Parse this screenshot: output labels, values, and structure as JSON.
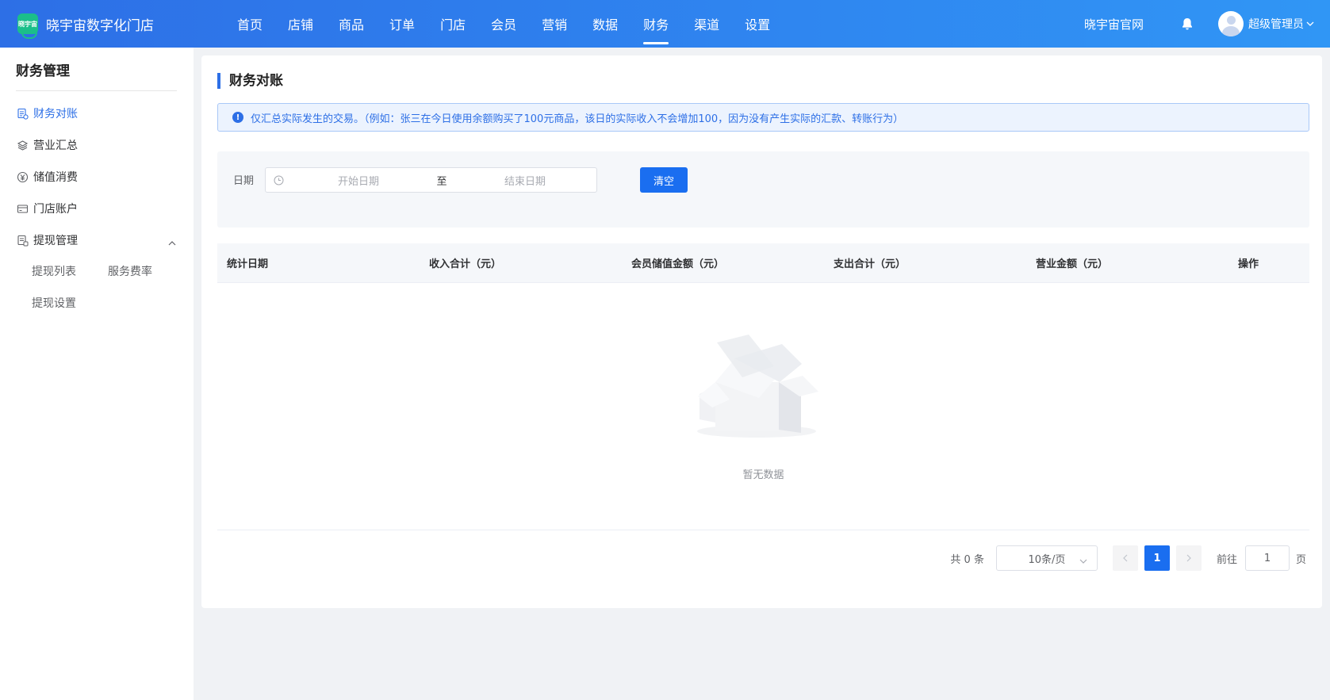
{
  "header": {
    "logo_text": "晓宇宙",
    "brand_title": "晓宇宙数字化门店",
    "nav": [
      {
        "label": "首页",
        "active": false
      },
      {
        "label": "店铺",
        "active": false
      },
      {
        "label": "商品",
        "active": false
      },
      {
        "label": "订单",
        "active": false
      },
      {
        "label": "门店",
        "active": false
      },
      {
        "label": "会员",
        "active": false
      },
      {
        "label": "营销",
        "active": false
      },
      {
        "label": "数据",
        "active": false
      },
      {
        "label": "财务",
        "active": true
      },
      {
        "label": "渠道",
        "active": false
      },
      {
        "label": "设置",
        "active": false
      }
    ],
    "site_link": "晓宇宙官网",
    "user_name": "超级管理员"
  },
  "sidebar": {
    "title": "财务管理",
    "items": [
      {
        "label": "财务对账",
        "icon": "reconcile-icon",
        "active": true
      },
      {
        "label": "营业汇总",
        "icon": "layers-icon",
        "active": false
      },
      {
        "label": "储值消费",
        "icon": "yen-icon",
        "active": false
      },
      {
        "label": "门店账户",
        "icon": "card-icon",
        "active": false
      },
      {
        "label": "提现管理",
        "icon": "withdraw-icon",
        "active": false,
        "expanded": true
      }
    ],
    "sub_items": [
      "提现列表",
      "服务费率",
      "提现设置"
    ]
  },
  "main": {
    "title": "财务对账",
    "notice": "仅汇总实际发生的交易。（例如：张三在今日使用余额购买了100元商品，该日的实际收入不会增加100，因为没有产生实际的汇款、转账行为）",
    "filter": {
      "date_label": "日期",
      "start_placeholder": "开始日期",
      "separator": "至",
      "end_placeholder": "结束日期",
      "clear_label": "清空"
    },
    "table": {
      "columns": [
        "统计日期",
        "收入合计（元）",
        "会员储值金额（元）",
        "支出合计（元）",
        "营业金额（元）",
        "操作"
      ],
      "rows": [],
      "empty_text": "暂无数据"
    },
    "pagination": {
      "total_text": "共 0 条",
      "page_size": "10条/页",
      "current_page": "1",
      "goto_label": "前往",
      "goto_value": "1",
      "page_unit": "页"
    }
  },
  "colors": {
    "primary": "#1a6ef0",
    "header_gradient_start": "#2d6fe6",
    "header_gradient_end": "#3096f5",
    "notice_bg": "#ecf3fe"
  }
}
